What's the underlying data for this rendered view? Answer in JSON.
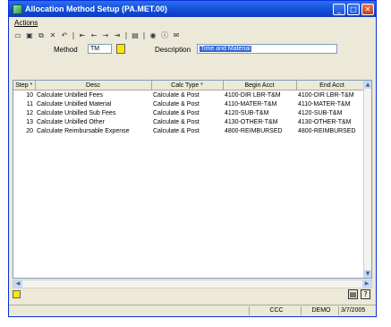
{
  "window": {
    "title": "Allocation Method Setup (PA.MET.00)"
  },
  "menu": {
    "items": [
      "Actions"
    ]
  },
  "toolbar": {
    "icons": [
      "new-icon",
      "save-icon",
      "copy-icon",
      "delete-icon",
      "cancel-icon",
      "first-icon",
      "previous-icon",
      "next-icon",
      "last-icon",
      "print-icon",
      "help-icon",
      "info-icon",
      "mail-icon"
    ]
  },
  "form": {
    "method_label": "Method",
    "method_value": "TM",
    "description_label": "Description",
    "description_value": "Time and Material"
  },
  "grid": {
    "columns": [
      "Step *",
      "Desc",
      "Calc Type *",
      "Begin Acct",
      "End Acct"
    ],
    "rows": [
      {
        "step": "10",
        "desc": "Calculate Unbilled Fees",
        "calc": "Calculate & Post",
        "begin": "4100-DIR LBR-T&M",
        "end": "4100-DIR LBR-T&M"
      },
      {
        "step": "11",
        "desc": "Calculate Unbilled Material",
        "calc": "Calculate & Post",
        "begin": "4110-MATER-T&M",
        "end": "4110-MATER-T&M"
      },
      {
        "step": "12",
        "desc": "Calculate Unbilled Sub Fees",
        "calc": "Calculate & Post",
        "begin": "4120-SUB-T&M",
        "end": "4120-SUB-T&M"
      },
      {
        "step": "13",
        "desc": "Calculate Unbilled Other",
        "calc": "Calculate & Post",
        "begin": "4130-OTHER-T&M",
        "end": "4130-OTHER-T&M"
      },
      {
        "step": "20",
        "desc": "Calculate Reimbursable Expense",
        "calc": "Calculate & Post",
        "begin": "4800-REIMBURSED",
        "end": "4800-REIMBURSED"
      }
    ]
  },
  "status": {
    "company": "CCC",
    "database": "DEMO",
    "date": "3/7/2005"
  }
}
